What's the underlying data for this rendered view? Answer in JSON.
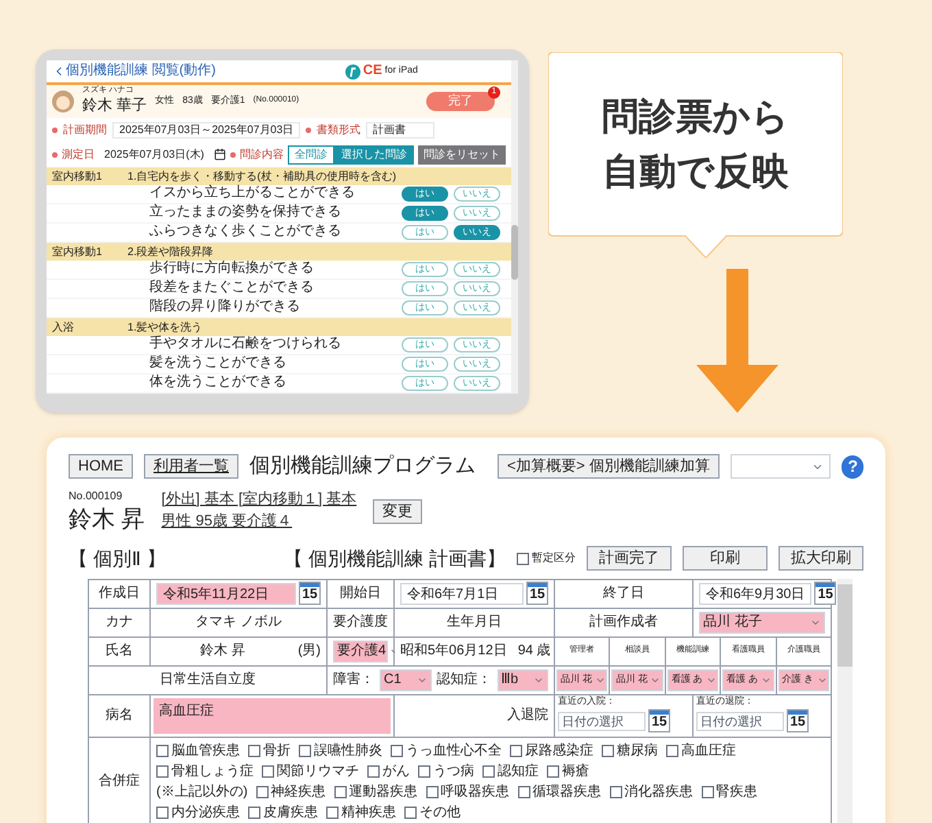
{
  "tablet": {
    "back_link": "個別機能訓練 閲覧(動作)",
    "logo": {
      "text": "CE",
      "sub": "for iPad"
    },
    "patient": {
      "kana": "スズキ ハナコ",
      "name": "鈴木 華子",
      "sex": "女性",
      "age": "83歳",
      "care_level": "要介護1",
      "number": "(No.000010)"
    },
    "complete_button": {
      "label": "完了",
      "badge": "1"
    },
    "plan_period": {
      "label": "計画期間",
      "value": "2025年07月03日～2025年07月03日"
    },
    "document_type": {
      "label": "書類形式",
      "value": "計画書"
    },
    "measure_date": {
      "label": "測定日",
      "value": "2025年07月03日(木)"
    },
    "interview": {
      "label": "問診内容",
      "options": [
        {
          "label": "全問診",
          "selected": false
        },
        {
          "label": "選択した問診",
          "selected": true
        }
      ],
      "reset": "問診をリセット"
    },
    "sections": [
      {
        "category": "室内移動1",
        "title": "1.自宅内を歩く・移動する(杖・補助具の使用時を含む)",
        "items": [
          {
            "text": "イスから立ち上がることができる",
            "answers": [
              {
                "label": "はい",
                "selected": true
              },
              {
                "label": "いいえ",
                "selected": false
              }
            ]
          },
          {
            "text": "立ったままの姿勢を保持できる",
            "answers": [
              {
                "label": "はい",
                "selected": true
              },
              {
                "label": "いいえ",
                "selected": false
              }
            ]
          },
          {
            "text": "ふらつきなく歩くことができる",
            "answers": [
              {
                "label": "はい",
                "selected": false
              },
              {
                "label": "いいえ",
                "selected": true
              }
            ]
          }
        ]
      },
      {
        "category": "室内移動1",
        "title": "2.段差や階段昇降",
        "items": [
          {
            "text": "歩行時に方向転換ができる",
            "answers": [
              {
                "label": "はい",
                "selected": false
              },
              {
                "label": "いいえ",
                "selected": false
              }
            ]
          },
          {
            "text": "段差をまたぐことができる",
            "answers": [
              {
                "label": "はい",
                "selected": false
              },
              {
                "label": "いいえ",
                "selected": false
              }
            ]
          },
          {
            "text": "階段の昇り降りができる",
            "answers": [
              {
                "label": "はい",
                "selected": false
              },
              {
                "label": "いいえ",
                "selected": false
              }
            ]
          }
        ]
      },
      {
        "category": "入浴",
        "title": "1.髪や体を洗う",
        "items": [
          {
            "text": "手やタオルに石鹸をつけられる",
            "answers": [
              {
                "label": "はい",
                "selected": false
              },
              {
                "label": "いいえ",
                "selected": false
              }
            ]
          },
          {
            "text": "髪を洗うことができる",
            "answers": [
              {
                "label": "はい",
                "selected": false
              },
              {
                "label": "いいえ",
                "selected": false
              }
            ]
          },
          {
            "text": "体を洗うことができる",
            "answers": [
              {
                "label": "はい",
                "selected": false
              },
              {
                "label": "いいえ",
                "selected": false
              }
            ]
          }
        ]
      }
    ]
  },
  "callout": {
    "lines": [
      "問診票から",
      "自動で反映"
    ]
  },
  "screen": {
    "toolbar": {
      "home": "HOME",
      "users": "利用者一覧",
      "title": "個別機能訓練プログラム",
      "addition_button": "<加算概要> 個別機能訓練加算",
      "help": "?"
    },
    "user": {
      "number": "No.000109",
      "name": "鈴木 昇",
      "links": [
        "[外出] 基本 [室内移動１] 基本",
        "男性 95歳 要介護４"
      ],
      "change": "変更"
    },
    "level": "【 個別Ⅱ 】",
    "plan_title": "【 個別機能訓練 計画書】",
    "provisional": {
      "label": "暫定区分",
      "checked": false
    },
    "actions": [
      "計画完了",
      "印刷",
      "拡大印刷"
    ],
    "table": {
      "created": {
        "label": "作成日",
        "value": "令和5年11月22日",
        "highlighted": true,
        "calendar": "15"
      },
      "start": {
        "label": "開始日",
        "value": "令和6年7月1日",
        "highlighted": false,
        "calendar": "15"
      },
      "end": {
        "label": "終了日",
        "value": "令和6年9月30日",
        "highlighted": false,
        "calendar": "15"
      },
      "kana": {
        "label": "カナ",
        "value": "タマキ ノボル"
      },
      "care_level_label": "要介護度",
      "birth_label": "生年月日",
      "planner": {
        "label": "計画作成者",
        "value": "品川 花子",
        "highlighted": true
      },
      "name": {
        "label": "氏名",
        "value": "鈴木 昇",
        "sex": "(男)"
      },
      "care_level": {
        "value": "要介護4",
        "highlighted": true
      },
      "birth": {
        "value": "昭和5年06月12日",
        "age": "94 歳"
      },
      "staff": [
        {
          "role": "管理者",
          "value": "品川 花",
          "highlighted": true
        },
        {
          "role": "相談員",
          "value": "品川 花",
          "highlighted": true
        },
        {
          "role": "機能訓練",
          "value": "看護 あ",
          "highlighted": true
        },
        {
          "role": "看護職員",
          "value": "看護 あ",
          "highlighted": true
        },
        {
          "role": "介護職員",
          "value": "介護 き",
          "highlighted": true
        }
      ],
      "independence": {
        "label": "日常生活自立度",
        "disability_label": "障害：",
        "disability": {
          "value": "C1",
          "highlighted": true
        },
        "dementia_label": "認知症：",
        "dementia": {
          "value": "Ⅲb",
          "highlighted": true
        }
      },
      "disease": {
        "label": "病名",
        "value": "高血圧症",
        "highlighted": true
      },
      "hospital": {
        "label": "入退院",
        "admission": {
          "caption": "直近の入院：",
          "placeholder": "日付の選択",
          "calendar": "15"
        },
        "discharge": {
          "caption": "直近の退院：",
          "placeholder": "日付の選択",
          "calendar": "15"
        }
      },
      "complications": {
        "label": "合併症",
        "lines": [
          [
            {
              "kind": "check",
              "label": "脳血管疾患",
              "checked": false
            },
            {
              "kind": "check",
              "label": "骨折",
              "checked": false
            },
            {
              "kind": "check",
              "label": "誤嚥性肺炎",
              "checked": false
            },
            {
              "kind": "check",
              "label": "うっ血性心不全",
              "checked": false
            },
            {
              "kind": "check",
              "label": "尿路感染症",
              "checked": false
            },
            {
              "kind": "check",
              "label": "糖尿病",
              "checked": false
            },
            {
              "kind": "check",
              "label": "高血圧症",
              "checked": false
            }
          ],
          [
            {
              "kind": "check",
              "label": "骨粗しょう症",
              "checked": false
            },
            {
              "kind": "check",
              "label": "関節リウマチ",
              "checked": false
            },
            {
              "kind": "check",
              "label": "がん",
              "checked": false
            },
            {
              "kind": "check",
              "label": "うつ病",
              "checked": false
            },
            {
              "kind": "check",
              "label": "認知症",
              "checked": false
            },
            {
              "kind": "check",
              "label": "褥瘡",
              "checked": false
            }
          ],
          [
            {
              "kind": "note",
              "label": "(※上記以外の)"
            },
            {
              "kind": "check",
              "label": "神経疾患",
              "checked": false
            },
            {
              "kind": "check",
              "label": "運動器疾患",
              "checked": false
            },
            {
              "kind": "check",
              "label": "呼吸器疾患",
              "checked": false
            },
            {
              "kind": "check",
              "label": "循環器疾患",
              "checked": false
            },
            {
              "kind": "check",
              "label": "消化器疾患",
              "checked": false
            },
            {
              "kind": "check",
              "label": "腎疾患",
              "checked": false
            }
          ],
          [
            {
              "kind": "check",
              "label": "内分泌疾患",
              "checked": false
            },
            {
              "kind": "check",
              "label": "皮膚疾患",
              "checked": false
            },
            {
              "kind": "check",
              "label": "精神疾患",
              "checked": false
            },
            {
              "kind": "check",
              "label": "その他",
              "checked": false
            }
          ]
        ]
      }
    }
  }
}
